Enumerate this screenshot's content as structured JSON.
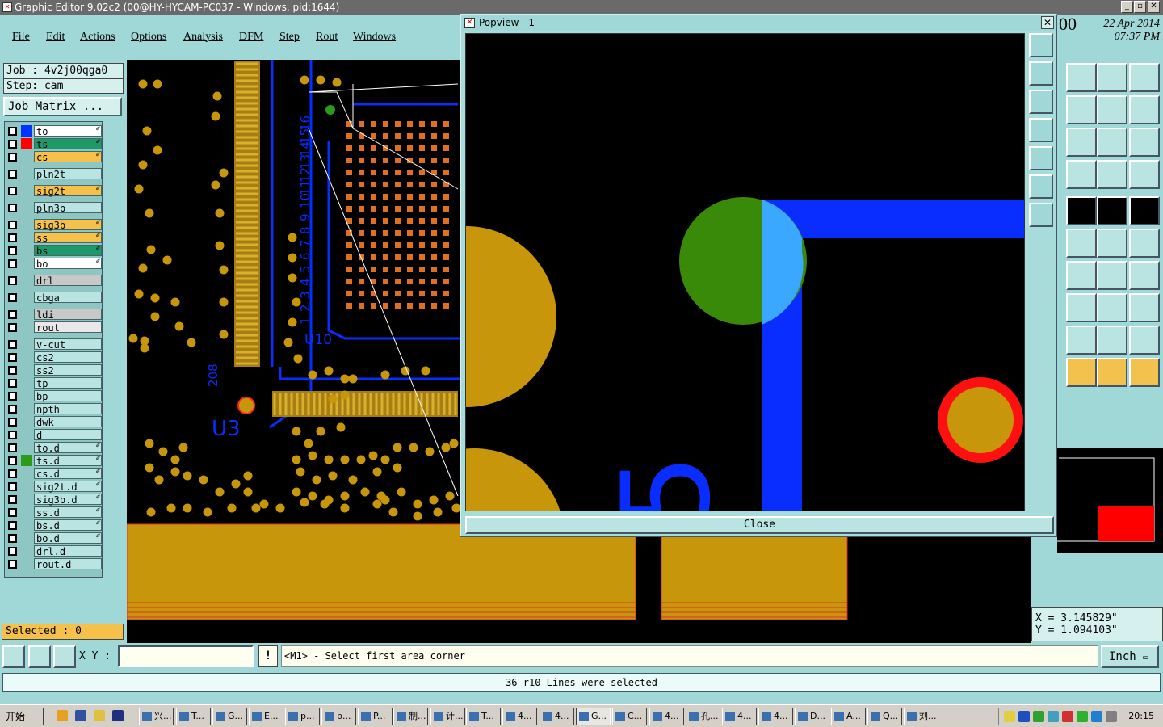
{
  "window": {
    "title": "Graphic Editor 9.02c2 (00@HY-HYCAM-PC037 - Windows, pid:1644)"
  },
  "menu": [
    "File",
    "Edit",
    "Actions",
    "Options",
    "Analysis",
    "DFM",
    "Step",
    "Rout",
    "Windows"
  ],
  "job": {
    "job_label": "Job : 4v2j00qga0",
    "step_label": "Step: cam",
    "matrix_button": "Job Matrix ..."
  },
  "layers": [
    {
      "name": "to",
      "color": "#0033ff",
      "bg": "#ffffff",
      "edit": true
    },
    {
      "name": "ts",
      "color": "#ff0000",
      "bg": "#1e9a6a",
      "edit": true
    },
    {
      "name": "cs",
      "color": "",
      "bg": "#f5c14a",
      "edit": true
    },
    {
      "name": "pln2t",
      "color": "",
      "bg": "#b9e4e2",
      "edit": false
    },
    {
      "name": "sig2t",
      "color": "",
      "bg": "#f5c14a",
      "edit": true
    },
    {
      "name": "pln3b",
      "color": "",
      "bg": "#b9e4e2",
      "edit": false
    },
    {
      "name": "sig3b",
      "color": "",
      "bg": "#f5c14a",
      "edit": true
    },
    {
      "name": "ss",
      "color": "",
      "bg": "#f5c14a",
      "edit": true
    },
    {
      "name": "bs",
      "color": "",
      "bg": "#1e9a6a",
      "edit": true
    },
    {
      "name": "bo",
      "color": "",
      "bg": "#ffffff",
      "edit": true
    },
    {
      "name": "drl",
      "color": "",
      "bg": "#c8c8c8",
      "edit": false
    },
    {
      "name": "cbga",
      "color": "",
      "bg": "#b9e4e2",
      "edit": false
    },
    {
      "name": "ldi",
      "color": "",
      "bg": "#c8c8c8",
      "edit": false
    },
    {
      "name": "rout",
      "color": "",
      "bg": "#e8e8e8",
      "edit": false
    },
    {
      "name": "v-cut",
      "color": "",
      "bg": "#b9e4e2",
      "edit": false
    },
    {
      "name": "cs2",
      "color": "",
      "bg": "#b9e4e2",
      "edit": false
    },
    {
      "name": "ss2",
      "color": "",
      "bg": "#b9e4e2",
      "edit": false
    },
    {
      "name": "tp",
      "color": "",
      "bg": "#b9e4e2",
      "edit": false
    },
    {
      "name": "bp",
      "color": "",
      "bg": "#b9e4e2",
      "edit": false
    },
    {
      "name": "npth",
      "color": "",
      "bg": "#b9e4e2",
      "edit": false
    },
    {
      "name": "dwk",
      "color": "",
      "bg": "#b9e4e2",
      "edit": false
    },
    {
      "name": "d",
      "color": "",
      "bg": "#b9e4e2",
      "edit": false
    },
    {
      "name": "to.d",
      "color": "",
      "bg": "#b9e4e2",
      "edit": true
    },
    {
      "name": "ts.d",
      "color": "#2e9a1a",
      "bg": "#b9e4e2",
      "edit": true
    },
    {
      "name": "cs.d",
      "color": "",
      "bg": "#b9e4e2",
      "edit": true
    },
    {
      "name": "sig2t.d",
      "color": "",
      "bg": "#b9e4e2",
      "edit": true
    },
    {
      "name": "sig3b.d",
      "color": "",
      "bg": "#b9e4e2",
      "edit": true
    },
    {
      "name": "ss.d",
      "color": "",
      "bg": "#b9e4e2",
      "edit": true
    },
    {
      "name": "bs.d",
      "color": "",
      "bg": "#b9e4e2",
      "edit": true
    },
    {
      "name": "bo.d",
      "color": "",
      "bg": "#b9e4e2",
      "edit": true
    },
    {
      "name": "drl.d",
      "color": "",
      "bg": "#b9e4e2",
      "edit": false
    },
    {
      "name": "rout.d",
      "color": "",
      "bg": "#b9e4e2",
      "edit": false
    }
  ],
  "selected": "Selected : 0",
  "canvas_labels": {
    "u10": "U10",
    "u3": "U3",
    "n208": "208",
    "pin_numbers": [
      "16",
      "15",
      "14",
      "13",
      "12",
      "11",
      "10",
      "9",
      "8",
      "7",
      "6",
      "5",
      "4",
      "3",
      "2",
      "1"
    ]
  },
  "popview": {
    "title": "Popview - 1",
    "close_label": "Close",
    "glyph": "5"
  },
  "datetime": {
    "date": "22 Apr 2014",
    "time": "07:37 PM",
    "clipped": "00"
  },
  "coords": {
    "x": "X = 3.145829\"",
    "y": "Y = 1.094103\""
  },
  "command": {
    "xy_label": "X Y :",
    "xy_value": "",
    "prompt": "<M1> - Select first area corner",
    "unit": "Inch"
  },
  "status": "36 r10 Lines were selected",
  "taskbar": {
    "start": "开始",
    "items": [
      "兴...",
      "T...",
      "G...",
      "E...",
      "p...",
      "p...",
      "P...",
      "制...",
      "计...",
      "T...",
      "4...",
      "4...",
      "G...",
      "C...",
      "4...",
      "孔...",
      "4...",
      "4...",
      "D...",
      "A...",
      "Q...",
      "刘..."
    ],
    "active_index": 12,
    "clock": "20:15"
  },
  "colors": {
    "copper": "#c8960a",
    "trace": "#0a2dff",
    "panel": "#9fd8d6"
  }
}
